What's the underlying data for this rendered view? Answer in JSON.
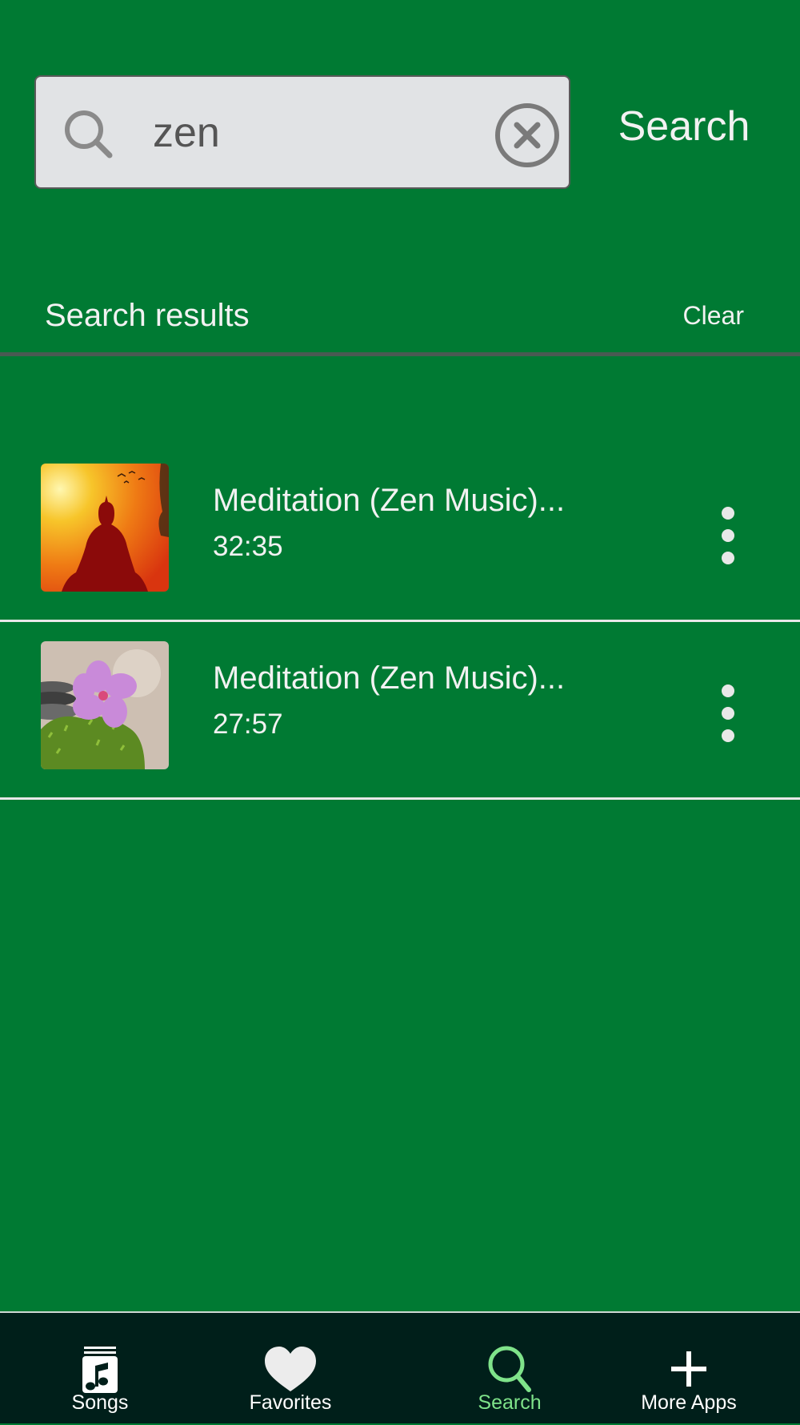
{
  "search": {
    "value": "zen",
    "button_label": "Search"
  },
  "results": {
    "header": "Search results",
    "clear_label": "Clear",
    "items": [
      {
        "title": "Meditation (Zen Music)...",
        "duration": "32:35",
        "thumb": "buddha-silhouette-sunset"
      },
      {
        "title": "Meditation (Zen Music)...",
        "duration": "27:57",
        "thumb": "pink-flower-zen-stones"
      }
    ]
  },
  "nav": {
    "items": [
      {
        "label": "Songs",
        "icon": "music-note-icon"
      },
      {
        "label": "Favorites",
        "icon": "heart-icon"
      },
      {
        "label": "Search",
        "icon": "search-icon",
        "active": true
      },
      {
        "label": "More Apps",
        "icon": "plus-icon"
      }
    ]
  },
  "colors": {
    "background": "#007a33",
    "nav_background": "#001f1a",
    "active_tab": "#7fe38a",
    "search_field": "#e1e3e5"
  }
}
